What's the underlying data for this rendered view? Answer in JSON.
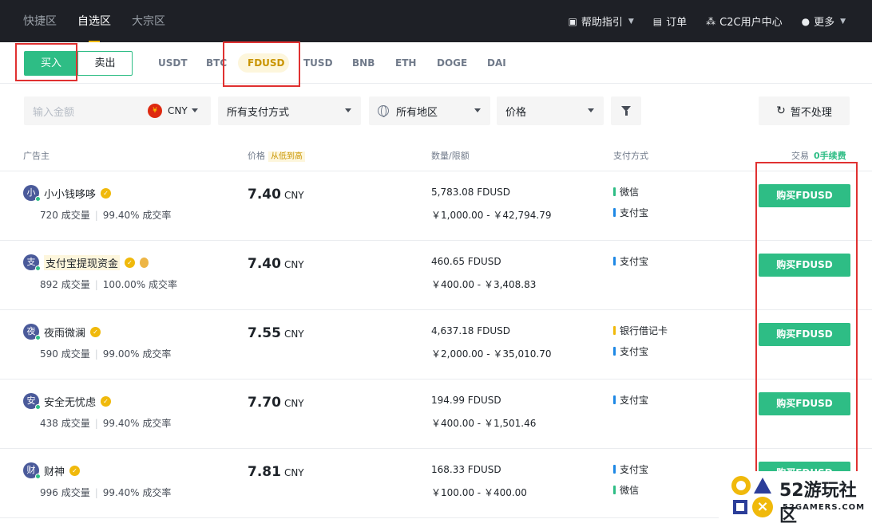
{
  "topnav": {
    "zones": [
      "快捷区",
      "自选区",
      "大宗区"
    ],
    "links": {
      "help": "帮助指引",
      "orders": "订单",
      "c2c": "C2C用户中心",
      "more": "更多"
    }
  },
  "tabs": {
    "buy": "买入",
    "sell": "卖出",
    "coins": [
      "USDT",
      "BTC",
      "FDUSD",
      "TUSD",
      "BNB",
      "ETH",
      "DOGE",
      "DAI"
    ],
    "selected_coin": "FDUSD"
  },
  "filters": {
    "amount_placeholder": "输入金额",
    "currency": "CNY",
    "currency_symbol": "¥",
    "payment": "所有支付方式",
    "region": "所有地区",
    "sort": "价格",
    "no_process": "暂不处理"
  },
  "table_header": {
    "advertiser": "广告主",
    "price": "价格",
    "price_sort": "从低到高",
    "quantity_limit": "数量/限额",
    "payment": "支付方式",
    "trade": "交易",
    "fee": "0手续费"
  },
  "rows": [
    {
      "avatar": "小",
      "name": "小小钱哆哆",
      "trades": "720 成交量",
      "rate": "99.40% 成交率",
      "price": "7.40",
      "currency": "CNY",
      "quantity": "5,783.08 FDUSD",
      "limit": "￥1,000.00 - ￥42,794.79",
      "payments": [
        "微信",
        "支付宝"
      ],
      "button": "购买FDUSD"
    },
    {
      "avatar": "支",
      "name": "支付宝提现资金",
      "trades": "892 成交量",
      "rate": "100.00% 成交率",
      "price": "7.40",
      "currency": "CNY",
      "quantity": "460.65 FDUSD",
      "limit": "￥400.00 - ￥3,408.83",
      "payments": [
        "支付宝"
      ],
      "button": "购买FDUSD"
    },
    {
      "avatar": "夜",
      "name": "夜雨微澜",
      "trades": "590 成交量",
      "rate": "99.00% 成交率",
      "price": "7.55",
      "currency": "CNY",
      "quantity": "4,637.18 FDUSD",
      "limit": "￥2,000.00 - ￥35,010.70",
      "payments": [
        "银行借记卡",
        "支付宝"
      ],
      "button": "购买FDUSD"
    },
    {
      "avatar": "安",
      "name": "安全无忧虑",
      "trades": "438 成交量",
      "rate": "99.40% 成交率",
      "price": "7.70",
      "currency": "CNY",
      "quantity": "194.99 FDUSD",
      "limit": "￥400.00 - ￥1,501.46",
      "payments": [
        "支付宝"
      ],
      "button": "购买FDUSD"
    },
    {
      "avatar": "财",
      "name": "财神",
      "trades": "996 成交量",
      "rate": "99.40% 成交率",
      "price": "7.81",
      "currency": "CNY",
      "quantity": "168.33 FDUSD",
      "limit": "￥100.00 - ￥400.00",
      "payments": [
        "支付宝",
        "微信"
      ],
      "button": "购买FDUSD"
    }
  ],
  "payment_colors": {
    "微信": "#2ebd85",
    "支付宝": "#1e88e5",
    "银行借记卡": "#f0b90b"
  },
  "watermark": {
    "title": "52游玩社区",
    "subtitle": "52GAMERS.COM"
  }
}
